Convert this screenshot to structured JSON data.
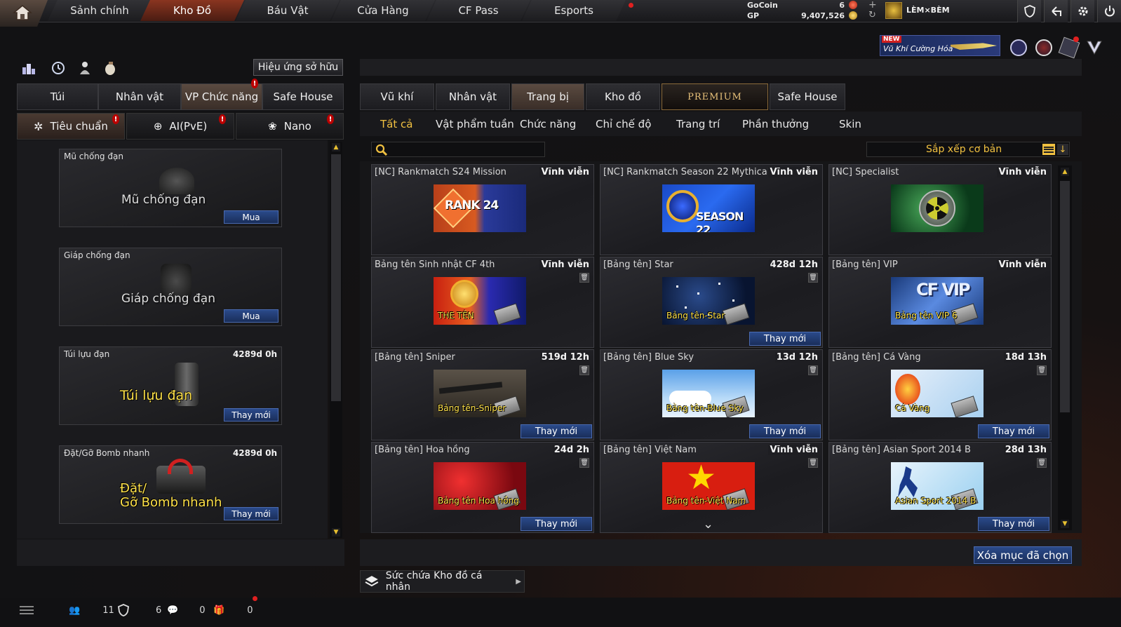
{
  "top_nav": {
    "tabs": [
      {
        "label": "Sảnh chính"
      },
      {
        "label": "Kho Đồ",
        "active": true
      },
      {
        "label": "Báu Vật"
      },
      {
        "label": "Cửa Hàng"
      },
      {
        "label": "CF Pass"
      },
      {
        "label": "Esports"
      }
    ],
    "currency": [
      {
        "name": "GoCoin",
        "value": "6"
      },
      {
        "name": "GP",
        "value": "9,407,526"
      }
    ],
    "player_name": "LÈM×BÈM",
    "promo_badge": "NEW",
    "promo_text": "Vũ Khí Cường Hóa",
    "icons": [
      "home-icon",
      "shield-icon",
      "exit-icon",
      "gear-icon",
      "power-icon"
    ]
  },
  "left_panel": {
    "effect_button": "Hiệu ứng sở hữu",
    "tabs": [
      {
        "label": "Túi"
      },
      {
        "label": "Nhân vật"
      },
      {
        "label": "VP Chức năng",
        "active": true
      },
      {
        "label": "Safe House"
      }
    ],
    "subtabs": [
      {
        "label": "Tiêu chuẩn",
        "active": true
      },
      {
        "label": "AI(PvE)"
      },
      {
        "label": "Nano"
      }
    ],
    "items": [
      {
        "name": "Mũ chống đạn",
        "duration": "",
        "image_text": "Mũ chống đạn",
        "button": "Mua"
      },
      {
        "name": "Giáp chống đạn",
        "duration": "",
        "image_text": "Giáp chống đạn",
        "button": "Mua"
      },
      {
        "name": "Túi lựu đạn",
        "duration": "4289d 0h",
        "image_text": "Túi lựu đạn",
        "button": "Thay mới"
      },
      {
        "name": "Đặt/Gỡ Bomb nhanh",
        "duration": "4289d 0h",
        "image_text_1": "Đặt/",
        "image_text_2": "Gỡ Bomb nhanh",
        "button": "Thay mới"
      }
    ]
  },
  "right_panel": {
    "tabs": [
      {
        "label": "Vũ khí"
      },
      {
        "label": "Nhân vật"
      },
      {
        "label": "Trang bị",
        "active": true
      },
      {
        "label": "Kho đồ"
      },
      {
        "label": "PREMIUM"
      },
      {
        "label": "Safe House"
      }
    ],
    "filters": [
      {
        "label": "Tất cả",
        "active": true
      },
      {
        "label": "Vật phẩm tuần"
      },
      {
        "label": "Chức năng"
      },
      {
        "label": "Chỉ chế độ"
      },
      {
        "label": "Trang trí"
      },
      {
        "label": "Phần thưởng"
      },
      {
        "label": "Skin"
      }
    ],
    "search": {
      "placeholder": ""
    },
    "sort": {
      "label": "Sắp xếp cơ bản"
    },
    "items": [
      {
        "name": "[NC] Rankmatch S24 Mission",
        "duration": "Vĩnh viễn",
        "thumb": "RANK 24",
        "title": "",
        "button": "",
        "trash": false,
        "theme": "rank"
      },
      {
        "name": "[NC] Rankmatch Season 22 Mythical",
        "duration": "Vĩnh viễn",
        "thumb": "SEASON 22",
        "title": "",
        "button": "",
        "trash": false,
        "theme": "season"
      },
      {
        "name": "[NC] Specialist",
        "duration": "Vĩnh viễn",
        "thumb": "",
        "title": "",
        "button": "",
        "trash": false,
        "theme": "nuclear"
      },
      {
        "name": "Bảng tên Sinh nhật CF 4th",
        "duration": "Vĩnh viễn",
        "thumb": "",
        "title": "THE TÊN",
        "button": "",
        "trash": true,
        "theme": "birthday"
      },
      {
        "name": "[Bảng tên] Star",
        "duration": "428d 12h",
        "thumb": "",
        "title": "Bảng tên-Star",
        "button": "Thay mới",
        "trash": true,
        "theme": "star"
      },
      {
        "name": "[Bảng tên] VIP",
        "duration": "Vĩnh viễn",
        "thumb": "CF VIP",
        "title": "Bảng tên VIP 6",
        "button": "",
        "trash": false,
        "theme": "vip"
      },
      {
        "name": "[Bảng tên] Sniper",
        "duration": "519d 12h",
        "thumb": "",
        "title": "Bảng tên-Sniper",
        "button": "Thay mới",
        "trash": true,
        "theme": "sniper"
      },
      {
        "name": "[Bảng tên] Blue Sky",
        "duration": "13d 12h",
        "thumb": "",
        "title": "Bảng tên-Blue Sky",
        "button": "Thay mới",
        "trash": true,
        "theme": "sky"
      },
      {
        "name": "[Bảng tên] Cá Vàng",
        "duration": "18d 13h",
        "thumb": "",
        "title": "Cá Vàng",
        "button": "Thay mới",
        "trash": true,
        "theme": "fish"
      },
      {
        "name": "[Bảng tên] Hoa hồng",
        "duration": "24d 2h",
        "thumb": "",
        "title": "Bảng tên Hoa hồng",
        "button": "Thay mới",
        "trash": true,
        "theme": "rose"
      },
      {
        "name": "[Bảng tên] Việt Nam",
        "duration": "Vĩnh viễn",
        "thumb": "",
        "title": "Bảng tên-Việt Nam",
        "button": "",
        "trash": true,
        "theme": "vietnam"
      },
      {
        "name": "[Bảng tên] Asian Sport 2014 B",
        "duration": "28d 13h",
        "thumb": "",
        "title": "Asian Sport 2014 B",
        "button": "Thay mới",
        "trash": true,
        "theme": "asian"
      }
    ],
    "delete_button": "Xóa mục đã chọn",
    "capacity_label": "Sức chứa Kho đồ cá nhân"
  },
  "status_bar": {
    "friends_count": "11",
    "clan_count": "6",
    "messages_count": "0",
    "gifts_count": "0"
  }
}
